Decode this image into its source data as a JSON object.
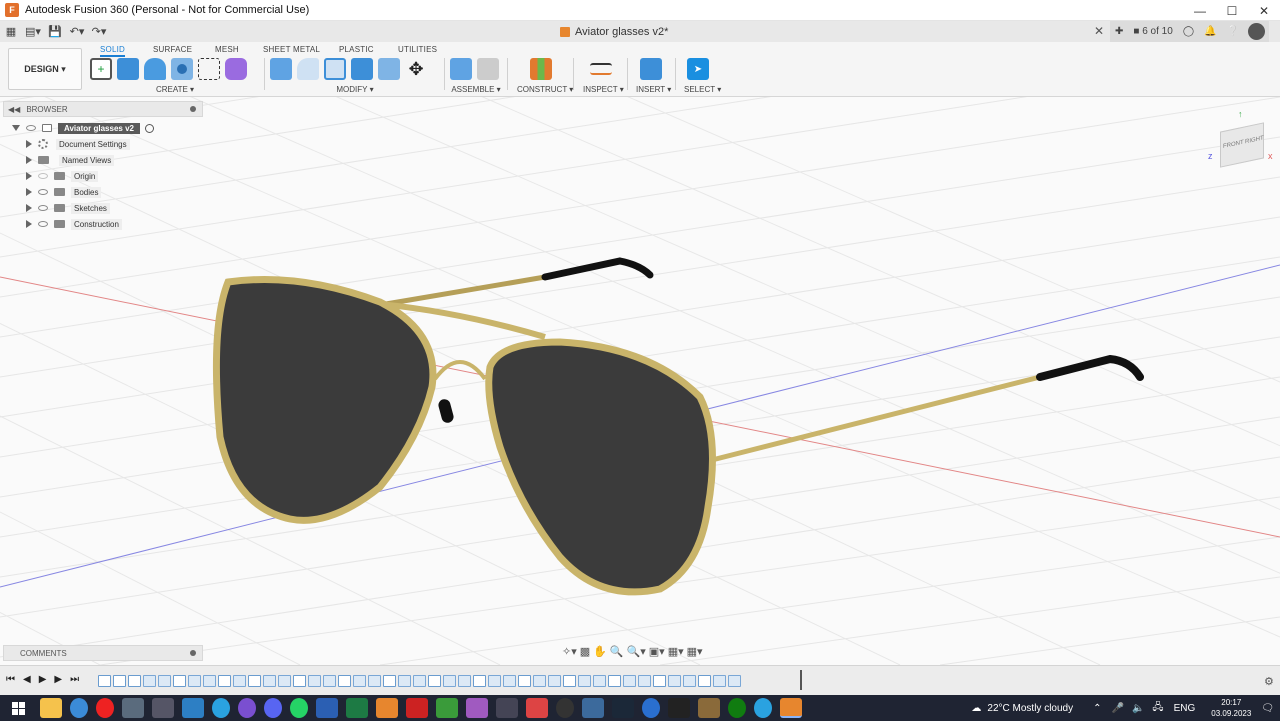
{
  "window": {
    "title": "Autodesk Fusion 360 (Personal - Not for Commercial Use)",
    "controls": [
      "minimize",
      "maximize",
      "close"
    ]
  },
  "header": {
    "document_title": "Aviator glasses v2*",
    "job_status": "6 of 10"
  },
  "ribbon": {
    "workspace": "DESIGN ▾",
    "tabs": [
      "SOLID",
      "SURFACE",
      "MESH",
      "SHEET METAL",
      "PLASTIC",
      "UTILITIES"
    ],
    "active_tab": "SOLID",
    "groups": {
      "create": "CREATE ▾",
      "modify": "MODIFY ▾",
      "assemble": "ASSEMBLE ▾",
      "construct": "CONSTRUCT ▾",
      "inspect": "INSPECT ▾",
      "insert": "INSERT ▾",
      "select": "SELECT ▾"
    }
  },
  "browser": {
    "title": "BROWSER",
    "root": "Aviator glasses v2",
    "items": [
      {
        "label": "Document Settings",
        "icon": "gear-icon"
      },
      {
        "label": "Named Views",
        "icon": "folder-icon"
      },
      {
        "label": "Origin",
        "icon": "folder-icon"
      },
      {
        "label": "Bodies",
        "icon": "folder-icon"
      },
      {
        "label": "Sketches",
        "icon": "folder-icon"
      },
      {
        "label": "Construction",
        "icon": "folder-icon"
      }
    ]
  },
  "comments": {
    "title": "COMMENTS"
  },
  "viewcube": {
    "front": "FRONT",
    "right": "RIGHT"
  },
  "taskbar": {
    "weather": "22°C  Mostly cloudy",
    "language": "ENG",
    "time": "20:17",
    "date": "03.09.2023"
  },
  "colors": {
    "accent": "#1a7fd4",
    "frame_gold": "#c9b46a",
    "lens": "#3a3a3a",
    "taskbar": "#1f2433"
  }
}
